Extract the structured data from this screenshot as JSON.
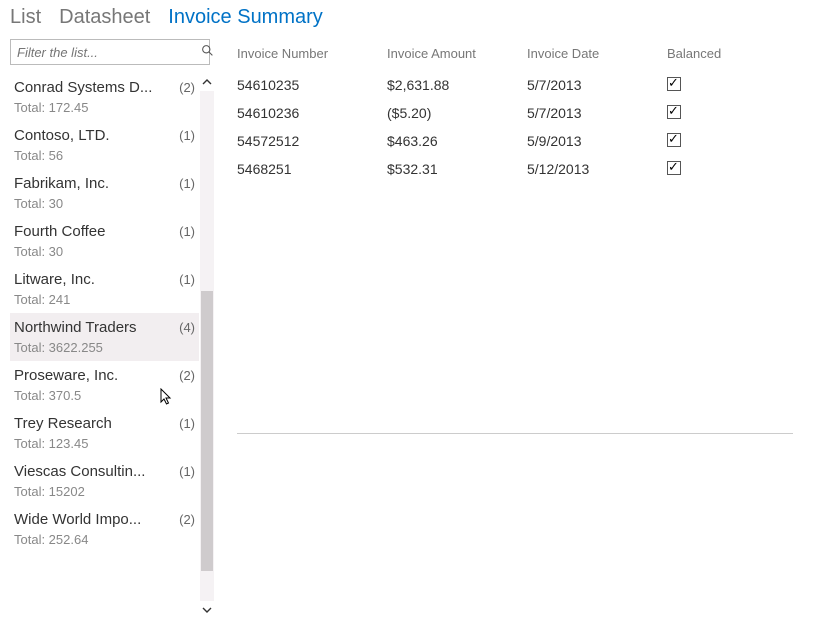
{
  "tabs": {
    "list": "List",
    "datasheet": "Datasheet",
    "invoice_summary": "Invoice Summary"
  },
  "filter": {
    "placeholder": "Filter the list..."
  },
  "sidebar": {
    "items": [
      {
        "name": "Conrad Systems D...",
        "count": "(2)",
        "sub": "Total: 172.45"
      },
      {
        "name": "Contoso, LTD.",
        "count": "(1)",
        "sub": "Total: 56"
      },
      {
        "name": "Fabrikam, Inc.",
        "count": "(1)",
        "sub": "Total: 30"
      },
      {
        "name": "Fourth Coffee",
        "count": "(1)",
        "sub": "Total: 30"
      },
      {
        "name": "Litware, Inc.",
        "count": "(1)",
        "sub": "Total: 241"
      },
      {
        "name": "Northwind Traders",
        "count": "(4)",
        "sub": "Total: 3622.255"
      },
      {
        "name": "Proseware, Inc.",
        "count": "(2)",
        "sub": "Total: 370.5"
      },
      {
        "name": "Trey Research",
        "count": "(1)",
        "sub": "Total: 123.45"
      },
      {
        "name": "Viescas Consultin...",
        "count": "(1)",
        "sub": "Total: 15202"
      },
      {
        "name": "Wide World Impo...",
        "count": "(2)",
        "sub": "Total: 252.64"
      }
    ],
    "selected_index": 5
  },
  "table": {
    "headers": {
      "number": "Invoice Number",
      "amount": "Invoice Amount",
      "date": "Invoice Date",
      "balanced": "Balanced"
    },
    "rows": [
      {
        "number": "54610235",
        "amount": "$2,631.88",
        "date": "5/7/2013",
        "balanced": true
      },
      {
        "number": "54610236",
        "amount": "($5.20)",
        "date": "5/7/2013",
        "balanced": true
      },
      {
        "number": "54572512",
        "amount": "$463.26",
        "date": "5/9/2013",
        "balanced": true
      },
      {
        "number": "5468251",
        "amount": "$532.31",
        "date": "5/12/2013",
        "balanced": true
      }
    ]
  }
}
